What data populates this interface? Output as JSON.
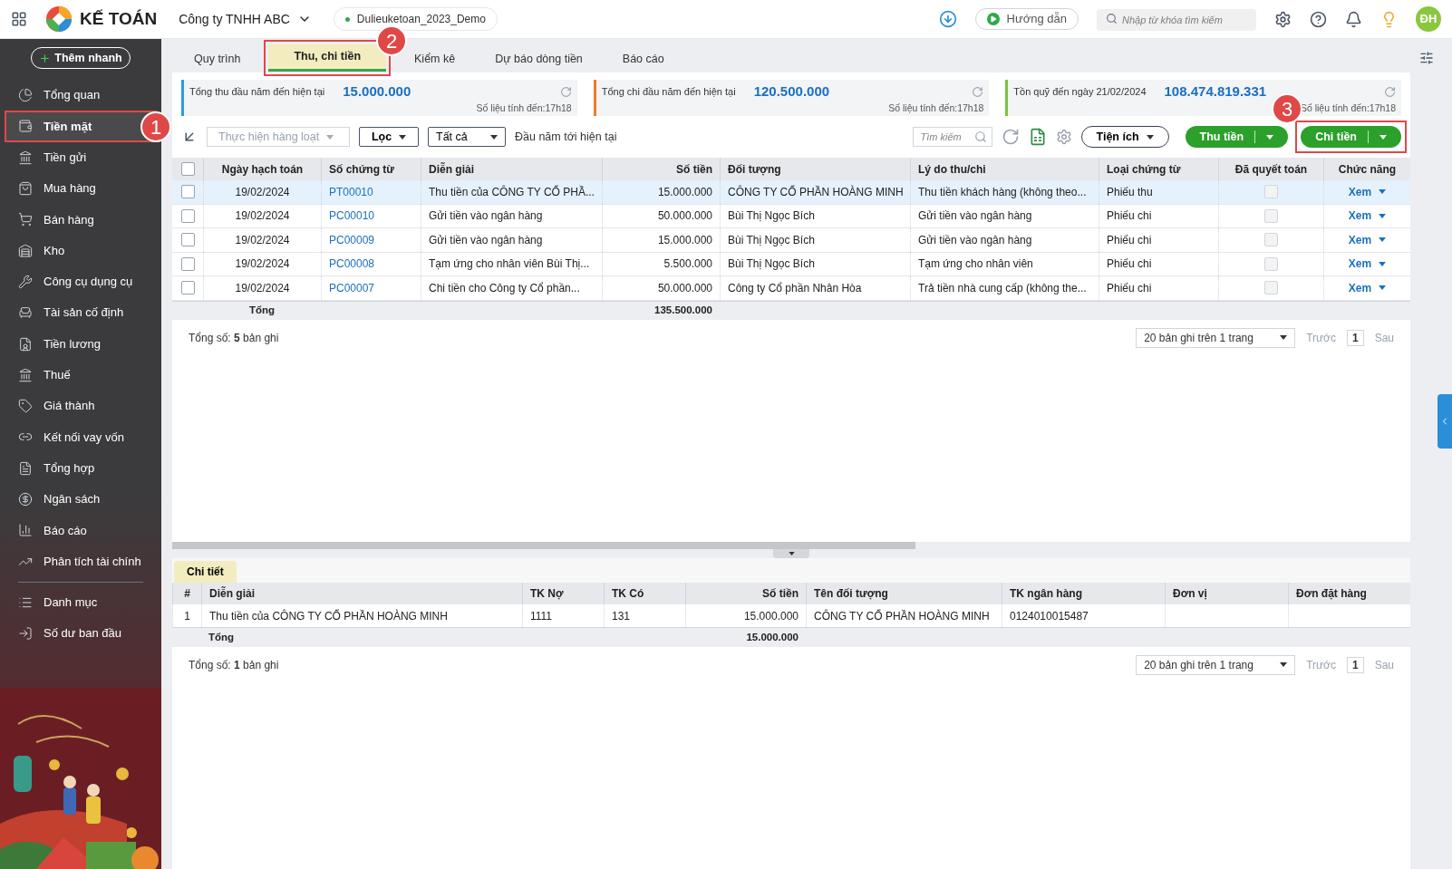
{
  "topbar": {
    "app_name": "KẾ TOÁN",
    "company": "Công ty TNHH ABC",
    "database": "Dulieuketoan_2023_Demo",
    "guide_button": "Hướng dẫn",
    "search": {
      "placeholder": "Nhập từ khóa tìm kiếm"
    },
    "avatar": "ĐH"
  },
  "sidebar": {
    "quick_add": "Thêm nhanh",
    "items": [
      {
        "label": "Tổng quan",
        "selected": false
      },
      {
        "label": "Tiền mặt",
        "selected": true
      },
      {
        "label": "Tiền gửi",
        "selected": false
      },
      {
        "label": "Mua hàng",
        "selected": false
      },
      {
        "label": "Bán hàng",
        "selected": false
      },
      {
        "label": "Kho",
        "selected": false
      },
      {
        "label": "Công cụ dụng cụ",
        "selected": false
      },
      {
        "label": "Tài sản cố định",
        "selected": false
      },
      {
        "label": "Tiền lương",
        "selected": false
      },
      {
        "label": "Thuế",
        "selected": false
      },
      {
        "label": "Giá thành",
        "selected": false
      },
      {
        "label": "Kết nối vay vốn",
        "selected": false
      },
      {
        "label": "Tổng hợp",
        "selected": false
      },
      {
        "label": "Ngân sách",
        "selected": false
      },
      {
        "label": "Báo cáo",
        "selected": false
      },
      {
        "label": "Phân tích tài chính",
        "selected": false
      }
    ],
    "bottom_items": [
      {
        "label": "Danh mục",
        "selected": false
      },
      {
        "label": "Số dư ban đầu",
        "selected": false
      }
    ]
  },
  "tabs": [
    {
      "label": "Quy trình",
      "selected": false
    },
    {
      "label": "Thu, chi tiền",
      "selected": true
    },
    {
      "label": "Kiểm kê",
      "selected": false
    },
    {
      "label": "Dự báo dòng tiền",
      "selected": false
    },
    {
      "label": "Báo cáo",
      "selected": false
    }
  ],
  "summary_cards": [
    {
      "label": "Tổng thu đầu năm đến hiện tại",
      "value": "15.000.000",
      "note": "Số liệu tính đến:17h18",
      "color": "#2b9be8"
    },
    {
      "label": "Tổng chi đầu năm đến hiện tại",
      "value": "120.500.000",
      "note": "Số liệu tính đến:17h18",
      "color": "#f07a2a"
    },
    {
      "label": "Tồn quỹ đến ngày 21/02/2024",
      "value": "108.474.819.331",
      "note": "Số liệu tính đến:17h18",
      "color": "#7cc242"
    }
  ],
  "toolbar": {
    "batch": "Thực hiện hàng loạt",
    "filter": "Lọc",
    "type": "Tất cả",
    "period": "Đầu năm tới hiện tại",
    "search": {
      "placeholder": "Tìm kiếm"
    },
    "utilities": "Tiện ích",
    "receive": "Thu tiền",
    "pay": "Chi tiền"
  },
  "table": {
    "columns": [
      "Ngày hạch toán",
      "Số chứng từ",
      "Diễn giải",
      "Số tiền",
      "Đối tượng",
      "Lý do thu/chi",
      "Loại chứng từ",
      "Đã quyết toán",
      "Chức năng"
    ],
    "rows": [
      {
        "selected": true,
        "checked": false,
        "date": "19/02/2024",
        "number": "PT00010",
        "description": "Thu tiền của CÔNG TY CỔ PHẦ...",
        "amount": "15.000.000",
        "object": "CÔNG TY CỔ PHẦN HOÀNG MINH",
        "reason": "Thu tiền khách hàng (không theo...",
        "type": "Phiếu thu",
        "settled": false,
        "action": "Xem"
      },
      {
        "selected": false,
        "checked": false,
        "date": "19/02/2024",
        "number": "PC00010",
        "description": "Gửi tiền vào ngân hàng",
        "amount": "50.000.000",
        "object": "Bùi Thị Ngọc Bích",
        "reason": "Gửi tiền vào ngân hàng",
        "type": "Phiếu chi",
        "settled": false,
        "action": "Xem"
      },
      {
        "selected": false,
        "checked": false,
        "date": "19/02/2024",
        "number": "PC00009",
        "description": "Gửi tiền vào ngân hàng",
        "amount": "15.000.000",
        "object": "Bùi Thị Ngọc Bích",
        "reason": "Gửi tiền vào ngân hàng",
        "type": "Phiếu chi",
        "settled": false,
        "action": "Xem"
      },
      {
        "selected": false,
        "checked": false,
        "date": "19/02/2024",
        "number": "PC00008",
        "description": "Tạm ứng cho nhân viên Bùi Thị...",
        "amount": "5.500.000",
        "object": "Bùi Thị Ngọc Bích",
        "reason": "Tạm ứng cho nhân viên",
        "type": "Phiếu chi",
        "settled": false,
        "action": "Xem"
      },
      {
        "selected": false,
        "checked": false,
        "date": "19/02/2024",
        "number": "PC00007",
        "description": "Chi tiền cho Công ty Cổ phần...",
        "amount": "50.000.000",
        "object": "Công ty Cổ phần Nhân Hòa",
        "reason": "Trả tiền nhà cung cấp (không the...",
        "type": "Phiếu chi",
        "settled": false,
        "action": "Xem"
      }
    ],
    "all_checked": false,
    "total_label": "Tổng",
    "total_amount": "135.500.000",
    "count": "Tổng số: **5** bản ghi",
    "page_size": "20 bản ghi trên 1 trang",
    "prev": "Trước",
    "page": "1",
    "next": "Sau"
  },
  "detail": {
    "tab": "Chi tiết",
    "columns": [
      "#",
      "Diễn giải",
      "TK Nợ",
      "TK Có",
      "Số tiền",
      "Tên đối tượng",
      "TK ngân hàng",
      "Đơn vị",
      "Đơn đặt hàng"
    ],
    "rows": [
      [
        "1",
        "Thu tiền của CÔNG TY CỔ PHẦN HOÀNG MINH",
        "1111",
        "131",
        "15.000.000",
        "CÔNG TY CỔ PHẦN HOÀNG MINH",
        "0124010015487",
        "",
        ""
      ]
    ],
    "total_label": "Tổng",
    "total_amount": "15.000.000",
    "count": "Tổng số: **1** bản ghi",
    "page_size": "20 bản ghi trên 1 trang",
    "prev": "Trước",
    "page": "1",
    "next": "Sau"
  },
  "annotations": [
    "1",
    "2",
    "3"
  ]
}
